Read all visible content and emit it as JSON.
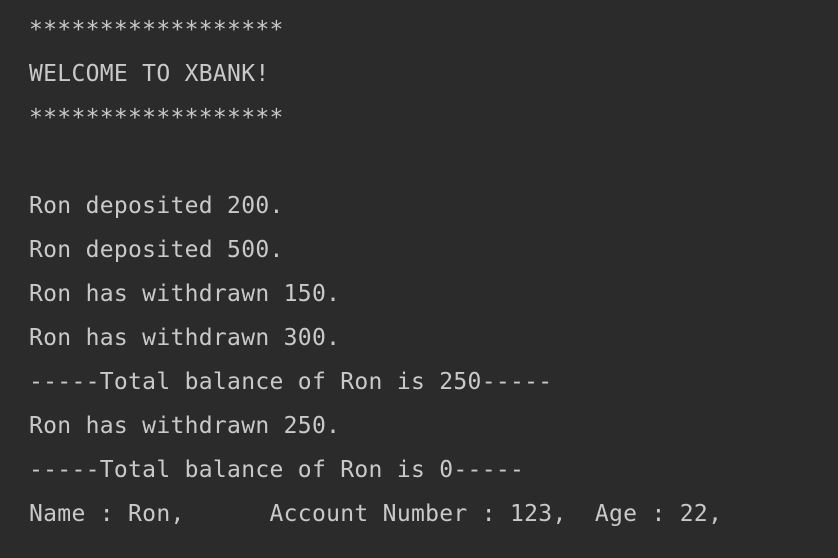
{
  "console": {
    "lines": [
      "******************",
      "WELCOME TO XBANK!",
      "******************",
      "",
      "Ron deposited 200.",
      "Ron deposited 500.",
      "Ron has withdrawn 150.",
      "Ron has withdrawn 300.",
      "-----Total balance of Ron is 250-----",
      "Ron has withdrawn 250.",
      "-----Total balance of Ron is 0-----",
      "Name : Ron,      Account Number : 123,  Age : 22,"
    ]
  },
  "colors": {
    "background": "#2b2b2b",
    "text": "#c9c9c9"
  }
}
